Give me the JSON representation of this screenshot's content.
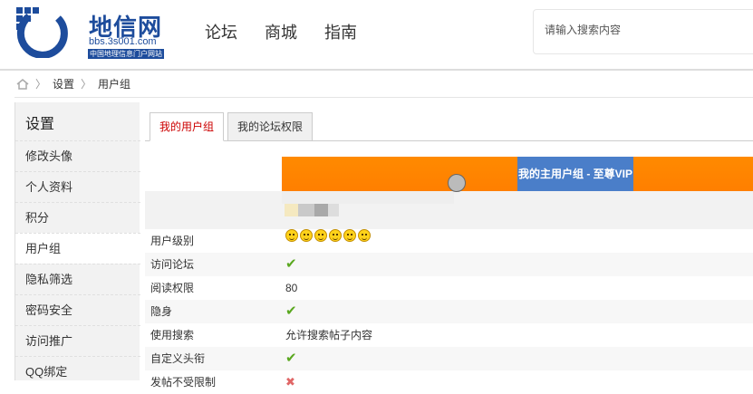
{
  "header": {
    "logo_text": "地信网",
    "logo_url": "bbs.3s001.com",
    "logo_subtitle": "中国地理信息门户网站",
    "nav": [
      "论坛",
      "商城",
      "指南"
    ],
    "search_placeholder": "请输入搜索内容"
  },
  "breadcrumb": [
    "设置",
    "用户组"
  ],
  "sidebar": {
    "title": "设置",
    "items": [
      "修改头像",
      "个人资料",
      "积分",
      "用户组",
      "隐私筛选",
      "密码安全",
      "访问推广",
      "QQ绑定"
    ],
    "active_index": 3
  },
  "tabs": [
    {
      "label": "我的用户组",
      "active": true
    },
    {
      "label": "我的论坛权限",
      "active": false
    }
  ],
  "group_header": {
    "label": "我的主用户组 - 至尊VIP",
    "bar_color": "#ff8000",
    "label_bg": "#4a7ec9"
  },
  "rows": [
    {
      "label": "用户级别",
      "value_type": "faces",
      "face_count": 6
    },
    {
      "label": "访问论坛",
      "value_type": "check"
    },
    {
      "label": "阅读权限",
      "value_type": "text",
      "value": "80"
    },
    {
      "label": "隐身",
      "value_type": "check"
    },
    {
      "label": "使用搜索",
      "value_type": "text",
      "value": "允许搜索帖子内容"
    },
    {
      "label": "自定义头衔",
      "value_type": "check"
    },
    {
      "label": "发帖不受限制",
      "value_type": "cross"
    }
  ],
  "colors": {
    "brand": "#1d4c9c",
    "check": "#5aa820",
    "cross": "#e06666",
    "active_tab_text": "#cc0000"
  }
}
